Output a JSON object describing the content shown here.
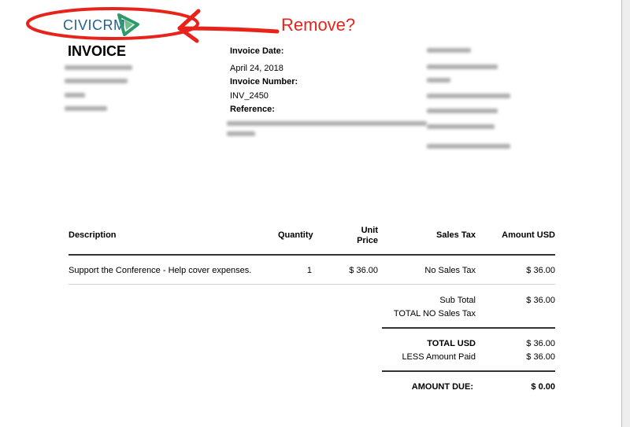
{
  "logo": {
    "text": "CIVICRM",
    "color": "#2a5f8f",
    "accent": "#2e9a6b"
  },
  "annotation": {
    "text": "Remove?",
    "color": "#e8231c"
  },
  "invoice": {
    "title": "INVOICE",
    "date_label": "Invoice Date:",
    "date_value": "April 24, 2018",
    "number_label": "Invoice Number:",
    "number_value": "INV_2450",
    "reference_label": "Reference:"
  },
  "table": {
    "headers": {
      "description": "Description",
      "quantity": "Quantity",
      "unit_price_line1": "Unit",
      "unit_price_line2": "Price",
      "sales_tax": "Sales Tax",
      "amount": "Amount USD"
    },
    "row": {
      "description": "Support the Conference - Help cover expenses.",
      "quantity": "1",
      "unit_price": "$ 36.00",
      "sales_tax": "No Sales Tax",
      "amount": "$ 36.00"
    }
  },
  "totals": {
    "sub_total_label": "Sub Total",
    "sub_total_value": "$ 36.00",
    "total_no_tax_label": "TOTAL NO Sales Tax",
    "total_usd_label": "TOTAL USD",
    "total_usd_value": "$ 36.00",
    "less_paid_label": "LESS Amount Paid",
    "less_paid_value": "$ 36.00",
    "amount_due_label": "AMOUNT DUE:",
    "amount_due_value": "$ 0.00"
  }
}
